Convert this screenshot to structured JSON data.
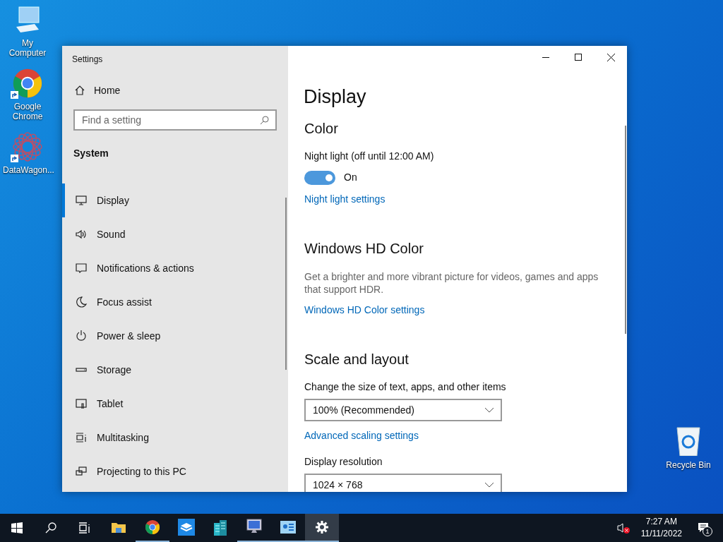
{
  "desktop_icons": [
    {
      "kind": "computer",
      "label": "My Computer",
      "shortcut": false
    },
    {
      "kind": "chrome",
      "label": "Google Chrome",
      "shortcut": true
    },
    {
      "kind": "mesh",
      "label": "DataWagon...",
      "shortcut": true
    }
  ],
  "recycle_bin": {
    "label": "Recycle Bin"
  },
  "window": {
    "title": "Settings",
    "sidebar": {
      "home": "Home",
      "search": {
        "placeholder": "Find a setting"
      },
      "section": "System",
      "items": [
        {
          "label": "Display",
          "selected": true
        },
        {
          "label": "Sound",
          "selected": false
        },
        {
          "label": "Notifications & actions",
          "selected": false
        },
        {
          "label": "Focus assist",
          "selected": false
        },
        {
          "label": "Power & sleep",
          "selected": false
        },
        {
          "label": "Storage",
          "selected": false
        },
        {
          "label": "Tablet",
          "selected": false
        },
        {
          "label": "Multitasking",
          "selected": false
        },
        {
          "label": "Projecting to this PC",
          "selected": false
        }
      ]
    },
    "content": {
      "title": "Display",
      "sections": [
        {
          "heading": "Color",
          "items": [
            {
              "kind": "toggle",
              "label": "Night light (off until 12:00 AM)",
              "on": true,
              "state_text": "On"
            },
            {
              "kind": "link",
              "text": "Night light settings"
            }
          ]
        },
        {
          "heading": "Windows HD Color",
          "items": [
            {
              "kind": "text",
              "text": "Get a brighter and more vibrant picture for videos, games and apps that support HDR."
            },
            {
              "kind": "link",
              "text": "Windows HD Color settings"
            }
          ]
        },
        {
          "heading": "Scale and layout",
          "items": [
            {
              "kind": "label",
              "text": "Change the size of text, apps, and other items"
            },
            {
              "kind": "dropdown",
              "value": "100% (Recommended)"
            },
            {
              "kind": "link",
              "text": "Advanced scaling settings"
            },
            {
              "kind": "label",
              "text": "Display resolution"
            },
            {
              "kind": "dropdown",
              "value": "1024 × 768"
            }
          ]
        }
      ]
    }
  },
  "taskbar": {
    "apps": [
      {
        "running": false,
        "selected": false
      },
      {
        "running": true,
        "selected": false
      },
      {
        "running": false,
        "selected": false
      },
      {
        "running": false,
        "selected": false
      },
      {
        "running": true,
        "selected": false
      },
      {
        "running": true,
        "selected": false
      },
      {
        "running": true,
        "selected": true
      }
    ],
    "muted": true,
    "time": "7:27 AM",
    "date": "11/11/2022",
    "notification_count": "1"
  }
}
